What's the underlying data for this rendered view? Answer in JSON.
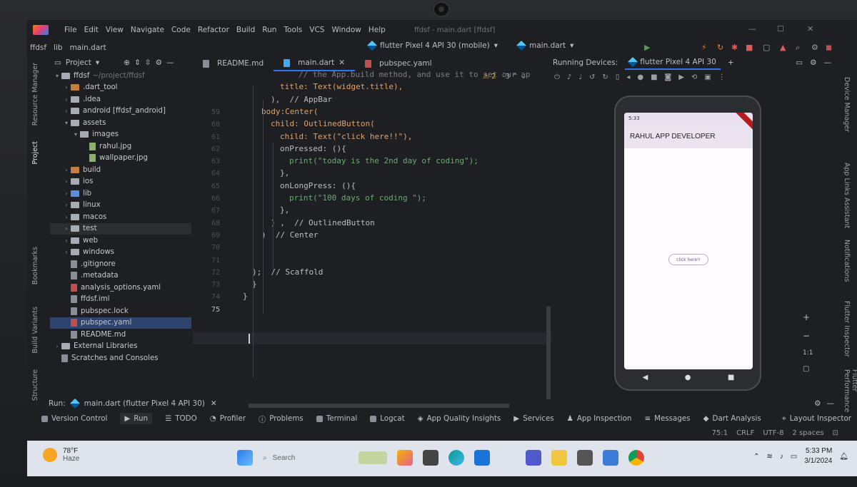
{
  "menu": [
    "File",
    "Edit",
    "View",
    "Navigate",
    "Code",
    "Refactor",
    "Build",
    "Run",
    "Tools",
    "VCS",
    "Window",
    "Help"
  ],
  "window_title": "ffdsf - main.dart [ffdsf]",
  "breadcrumb": [
    "ffdsf",
    "lib",
    "main.dart"
  ],
  "run_config": {
    "device": "flutter Pixel 4 API 30 (mobile)",
    "file": "main.dart"
  },
  "project": {
    "header": "Project",
    "tree": [
      {
        "name": "ffdsf",
        "extra": "~/project/ffdsf",
        "depth": 0,
        "kind": "folder",
        "open": true
      },
      {
        "name": ".dart_tool",
        "depth": 1,
        "kind": "folder-orange"
      },
      {
        "name": ".idea",
        "depth": 1,
        "kind": "folder"
      },
      {
        "name": "android [ffdsf_android]",
        "depth": 1,
        "kind": "folder"
      },
      {
        "name": "assets",
        "depth": 1,
        "kind": "folder",
        "open": true
      },
      {
        "name": "images",
        "depth": 2,
        "kind": "folder",
        "open": true
      },
      {
        "name": "rahul.jpg",
        "depth": 3,
        "kind": "img"
      },
      {
        "name": "wallpaper.jpg",
        "depth": 3,
        "kind": "img"
      },
      {
        "name": "build",
        "depth": 1,
        "kind": "folder-orange"
      },
      {
        "name": "ios",
        "depth": 1,
        "kind": "folder"
      },
      {
        "name": "lib",
        "depth": 1,
        "kind": "folder-blue"
      },
      {
        "name": "linux",
        "depth": 1,
        "kind": "folder"
      },
      {
        "name": "macos",
        "depth": 1,
        "kind": "folder"
      },
      {
        "name": "test",
        "depth": 1,
        "kind": "folder",
        "hover": true
      },
      {
        "name": "web",
        "depth": 1,
        "kind": "folder"
      },
      {
        "name": "windows",
        "depth": 1,
        "kind": "folder"
      },
      {
        "name": ".gitignore",
        "depth": 1,
        "kind": "file"
      },
      {
        "name": ".metadata",
        "depth": 1,
        "kind": "file"
      },
      {
        "name": "analysis_options.yaml",
        "depth": 1,
        "kind": "yaml"
      },
      {
        "name": "ffdsf.iml",
        "depth": 1,
        "kind": "file"
      },
      {
        "name": "pubspec.lock",
        "depth": 1,
        "kind": "file"
      },
      {
        "name": "pubspec.yaml",
        "depth": 1,
        "kind": "yaml",
        "selected": true
      },
      {
        "name": "README.md",
        "depth": 1,
        "kind": "file"
      },
      {
        "name": "External Libraries",
        "depth": 0,
        "kind": "folder"
      },
      {
        "name": "Scratches and Consoles",
        "depth": 0,
        "kind": "file"
      }
    ]
  },
  "left_stripe": [
    "Resource Manager",
    "Project",
    "Bookmarks",
    "Build Variants",
    "Structure"
  ],
  "right_stripe": [
    "Device Manager",
    "App Links Assistant",
    "Notifications",
    "Flutter Inspector",
    "Flutter Performance"
  ],
  "tabs": [
    {
      "label": "README.md",
      "icon": "markdown-icon"
    },
    {
      "label": "main.dart",
      "icon": "dart-icon",
      "active": true
    },
    {
      "label": "pubspec.yaml",
      "icon": "yaml-icon"
    }
  ],
  "inspection": {
    "warnings": "2",
    "weak": "3"
  },
  "code": [
    {
      "ln": "",
      "text": "// the App.build method, and use it to set our ap"
    },
    {
      "ln": "",
      "text": "title: Text(widget.title),"
    },
    {
      "ln": "",
      "text": "),  // AppBar"
    },
    {
      "ln": "59",
      "text": "body:Center("
    },
    {
      "ln": "60",
      "text": "child: OutlinedButton("
    },
    {
      "ln": "61",
      "text": "child: Text(\"click here!!\"),"
    },
    {
      "ln": "62",
      "text": "onPressed: (){"
    },
    {
      "ln": "63",
      "text": "print(\"today is the 2nd day of coding\");"
    },
    {
      "ln": "64",
      "text": "},"
    },
    {
      "ln": "65",
      "text": "onLongPress: (){"
    },
    {
      "ln": "66",
      "text": "print(\"100 days of coding \");"
    },
    {
      "ln": "67",
      "text": "},"
    },
    {
      "ln": "68",
      "text": ") ,  // OutlinedButton"
    },
    {
      "ln": "69",
      "text": ")  // Center"
    },
    {
      "ln": "70",
      "text": ""
    },
    {
      "ln": "71",
      "text": ""
    },
    {
      "ln": "72",
      "text": ");  // Scaffold"
    },
    {
      "ln": "73",
      "text": "}"
    },
    {
      "ln": "74",
      "text": "}"
    },
    {
      "ln": "75",
      "text": ""
    }
  ],
  "devices": {
    "title": "Running Devices:",
    "tab": "flutter Pixel 4 API 30",
    "phone": {
      "time": "5:33",
      "appbar": "RAHUL APP DEVELOPER",
      "button": "click here!!"
    }
  },
  "zoom": {
    "plus": "+",
    "minus": "−",
    "ratio": "1:1"
  },
  "run_bar": {
    "label": "Run:",
    "config": "main.dart (flutter Pixel 4 API 30)"
  },
  "tool_windows": [
    "Version Control",
    "Run",
    "TODO",
    "Profiler",
    "Problems",
    "Terminal",
    "Logcat",
    "App Quality Insights",
    "Services",
    "App Inspection",
    "Messages",
    "Dart Analysis",
    "Layout Inspector"
  ],
  "status": {
    "position": "75:1",
    "line_sep": "CRLF",
    "encoding": "UTF-8",
    "indent": "2 spaces"
  },
  "taskbar": {
    "weather_temp": "78°F",
    "weather_desc": "Haze",
    "search_placeholder": "Search",
    "time": "5:33 PM",
    "date": "3/1/2024"
  }
}
